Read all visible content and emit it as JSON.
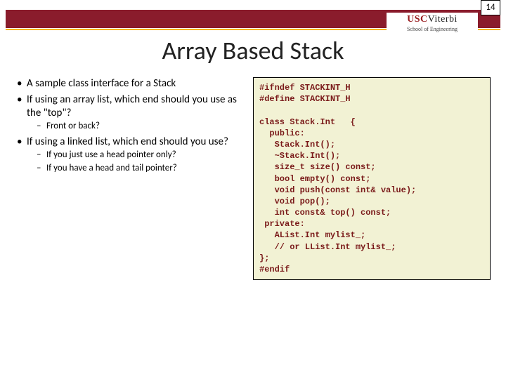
{
  "page_number": "14",
  "logo": {
    "usc": "USC",
    "viterbi": "Viterbi",
    "sub": "School of Engineering"
  },
  "title": "Array Based Stack",
  "bullets": {
    "b1": "A sample class interface for a Stack",
    "b2": "If using an array list, which end should you use as the \"top\"?",
    "b2_1": "Front or back?",
    "b3": "If using a linked list, which end should you use?",
    "b3_1": "If you just use a head pointer only?",
    "b3_2": "If you have a head and tail pointer?"
  },
  "code": "#ifndef STACKINT_H\n#define STACKINT_H\n\nclass Stack.Int   {\n  public:\n   Stack.Int();\n   ~Stack.Int();\n   size_t size() const;\n   bool empty() const;\n   void push(const int& value);\n   void pop();\n   int const& top() const;\n private:\n   AList.Int mylist_;\n   // or LList.Int mylist_;\n};\n#endif"
}
